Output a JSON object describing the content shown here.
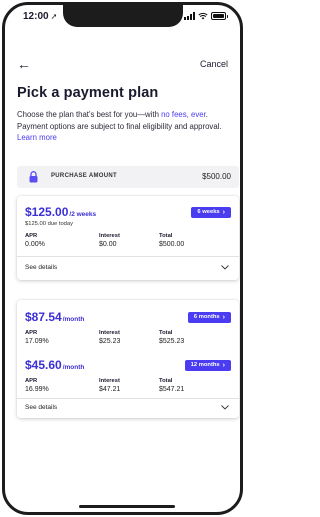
{
  "status": {
    "time": "12:00",
    "location_icon": "location-arrow-icon",
    "signal_icon": "signal-icon",
    "wifi_icon": "wifi-icon",
    "battery_icon": "battery-icon"
  },
  "nav": {
    "back_icon": "back-arrow-icon",
    "cancel_label": "Cancel"
  },
  "page": {
    "title": "Pick a payment plan",
    "intro_text_1": "Choose the plan that's best for you—with ",
    "intro_link_fees": "no fees, ever",
    "intro_text_2": ". Payment options are subject to final eligibility and approval. ",
    "intro_link_learn": "Learn more"
  },
  "purchase": {
    "icon": "lock-icon",
    "label": "PURCHASE AMOUNT",
    "amount": "$500.00"
  },
  "plans": [
    {
      "price": "$125.00",
      "per": "/2 weeks",
      "due_today": "$125.00 due today",
      "pill_label": "6 weeks",
      "apr_label": "APR",
      "apr": "0.00%",
      "interest_label": "Interest",
      "interest": "$0.00",
      "total_label": "Total",
      "total": "$500.00",
      "details_label": "See details"
    },
    {
      "price": "$87.54",
      "per": "/month",
      "pill_label": "6 months",
      "apr_label": "APR",
      "apr": "17.09%",
      "interest_label": "Interest",
      "interest": "$25.23",
      "total_label": "Total",
      "total": "$525.23"
    },
    {
      "price": "$45.60",
      "per": "/month",
      "pill_label": "12 months",
      "apr_label": "APR",
      "apr": "16.99%",
      "interest_label": "Interest",
      "interest": "$47.21",
      "total_label": "Total",
      "total": "$547.21",
      "details_label": "See details"
    }
  ],
  "colors": {
    "accent": "#4a3cf0",
    "price": "#3b2fd6",
    "purchase_bg": "#f2f2f4",
    "lock": "#5b4ef0"
  }
}
